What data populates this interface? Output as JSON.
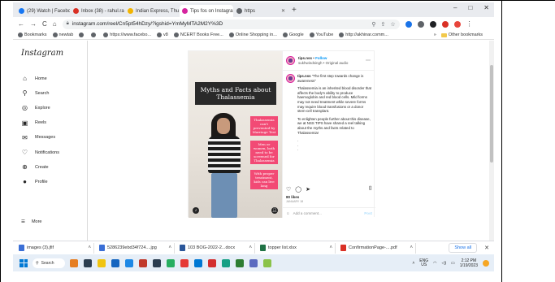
{
  "browser": {
    "tabs": [
      {
        "label": "(29) Watch | Facebook",
        "color": "#1877f2",
        "active": false
      },
      {
        "label": "Inbox (38) - rahul.rahimus0...",
        "color": "#d93025",
        "active": false
      },
      {
        "label": "Indian Express, Thu, 19 Jan...",
        "color": "#f2b400",
        "active": false
      },
      {
        "label": "Tips fos on Instagram: \"Th...",
        "color": "#d6249f",
        "active": true
      },
      {
        "label": "https",
        "color": "#5f6368",
        "active": false
      }
    ],
    "new_tab": "+",
    "window_controls": {
      "minimize": "–",
      "maximize": "□",
      "close": "✕"
    },
    "nav": {
      "back": "←",
      "forward": "→",
      "reload": "C",
      "home": "⌂"
    },
    "url": "instagram.com/reel/Cn5pt54hDzy/?igshid=YmMyMTA2M2Y%3D",
    "bookmarks": [
      "Bookmarks",
      "newtab",
      "",
      "",
      "https://www.facebo...",
      "v8",
      "NCERT Books Free...",
      "Online Shopping in...",
      "Google",
      "YouTube",
      "http://akhinar.comm..."
    ],
    "other_bookmarks": "Other bookmarks"
  },
  "instagram": {
    "logo": "Instagram",
    "nav": [
      {
        "icon": "home-icon",
        "glyph": "⌂",
        "label": "Home"
      },
      {
        "icon": "search-icon",
        "glyph": "⚲",
        "label": "Search"
      },
      {
        "icon": "explore-icon",
        "glyph": "◎",
        "label": "Explore"
      },
      {
        "icon": "reels-icon",
        "glyph": "▣",
        "label": "Reels"
      },
      {
        "icon": "messages-icon",
        "glyph": "✉",
        "label": "Messages"
      },
      {
        "icon": "heart-icon",
        "glyph": "♡",
        "label": "Notifications"
      },
      {
        "icon": "create-icon",
        "glyph": "⊕",
        "label": "Create"
      },
      {
        "icon": "profile-icon",
        "glyph": "●",
        "label": "Profile"
      }
    ],
    "more": {
      "glyph": "☰",
      "label": "More"
    },
    "post": {
      "username": "tips.nss",
      "follow": "Follow",
      "audio": "sukhwindsingh • Original audio",
      "title_overlay": "Myths and Facts about Thalassemia",
      "sticky_1": "Thalassemia can't prevented by Marriage Test",
      "sticky_2": "Men or women, both need to be screened for Thalassemia",
      "sticky_3": "With proper treatment, kids can live long",
      "caption_user": "tips.nss",
      "caption_1": "\"The first step towards change is awareness\"",
      "caption_2": "Thalassemia is an inherited blood disorder that affects the body's ability to produce haemoglobin and red blood cells. Mild forms may not need treatment while severe forms may require blood transfusions or a donor stem-cell transplant.",
      "caption_3": "To enlighten people further about this disease, we at NSS TIPS have shared a reel talking about the myths and facts related to Thalassemia!",
      "caption_dots": ".\n.\n.",
      "likes": "80 likes",
      "time_ago": "JANUARY 18",
      "comment_placeholder": "Add a comment...",
      "post_button": "Post"
    }
  },
  "downloads": [
    {
      "name": "images (3).jfif",
      "color": "#3b6fd6"
    },
    {
      "name": "5286239ebd34f724....jpg",
      "color": "#3b6fd6"
    },
    {
      "name": "103 BOG-2022-2...docx",
      "color": "#2b579a"
    },
    {
      "name": "topper list.xlsx",
      "color": "#217346"
    },
    {
      "name": "ConfirmationPage-....pdf",
      "color": "#d93025"
    }
  ],
  "downloads_show_all": "Show all",
  "taskbar": {
    "search": "Search",
    "apps": [
      "#e67e22",
      "#2c3e50",
      "#f1c40f",
      "#1565c0",
      "#1e88e5",
      "#c0392b",
      "#2c3e50",
      "#27ae60",
      "#e53935",
      "#0078d4",
      "#d32f2f",
      "#16a085",
      "#2e7d32",
      "#5c6bc0",
      "#8bc34a"
    ],
    "lang_1": "ENG",
    "lang_2": "US",
    "time": "2:12 PM",
    "date": "1/19/2023"
  }
}
